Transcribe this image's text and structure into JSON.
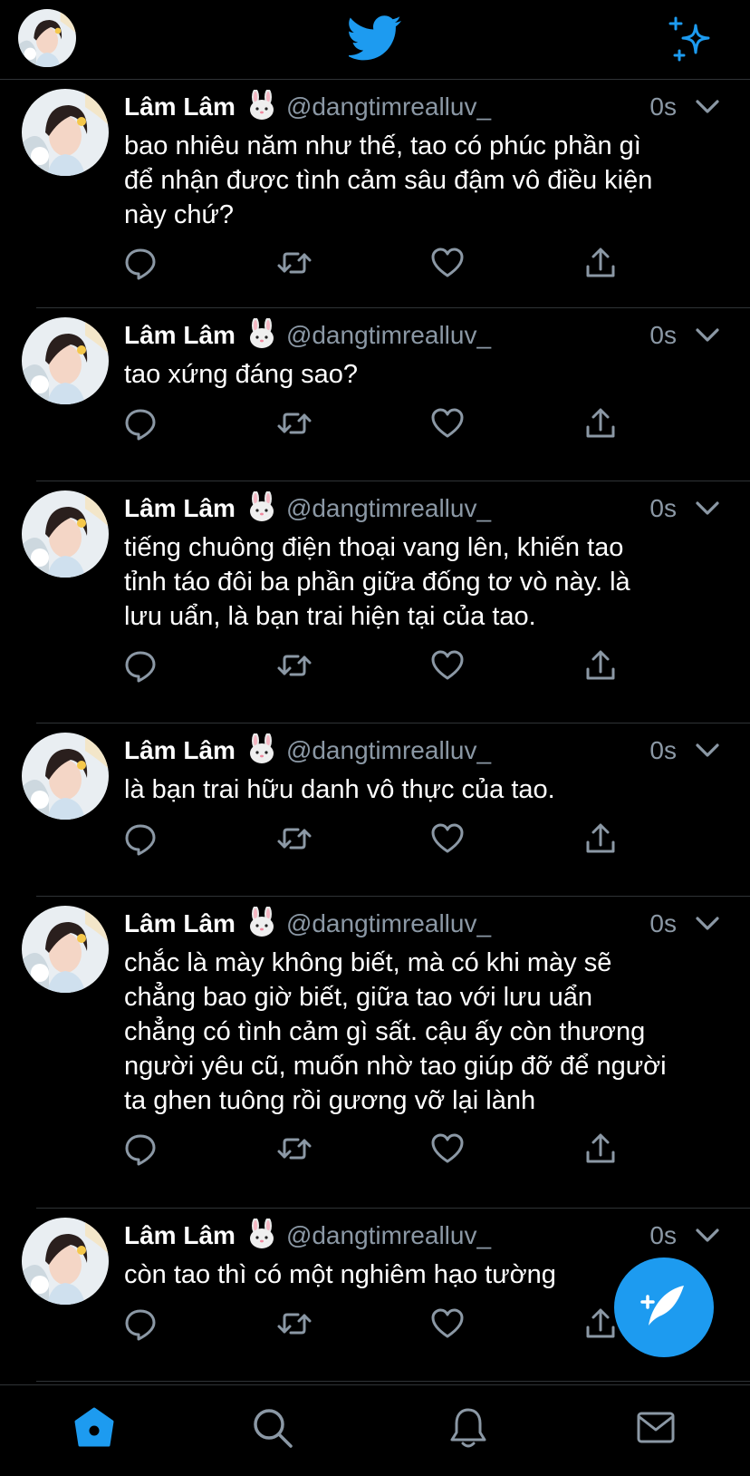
{
  "header": {
    "logo": "twitter-bird-icon",
    "right_icon": "sparkle-icon"
  },
  "tweets": [
    {
      "name": "Lâm Lâm",
      "emoji": "rabbit-face",
      "handle": "@dangtimrealluv_",
      "time": "0s",
      "lines": [
        "bao nhiêu năm như thế, tao có phúc phần gì",
        "để nhận được tình cảm sâu đậm vô điều kiện",
        "này chứ?"
      ]
    },
    {
      "name": "Lâm Lâm",
      "emoji": "rabbit-face",
      "handle": "@dangtimrealluv_",
      "time": "0s",
      "lines": [
        "tao xứng đáng sao?"
      ]
    },
    {
      "name": "Lâm Lâm",
      "emoji": "rabbit-face",
      "handle": "@dangtimrealluv_",
      "time": "0s",
      "lines": [
        "tiếng chuông điện thoại vang lên, khiến tao",
        "tỉnh táo đôi ba phần giữa đống tơ vò này. là",
        "lưu uẩn, là bạn trai hiện tại của tao."
      ]
    },
    {
      "name": "Lâm Lâm",
      "emoji": "rabbit-face",
      "handle": "@dangtimrealluv_",
      "time": "0s",
      "lines": [
        "là bạn trai hữu danh vô thực của tao."
      ]
    },
    {
      "name": "Lâm Lâm",
      "emoji": "rabbit-face",
      "handle": "@dangtimrealluv_",
      "time": "0s",
      "lines": [
        "chắc là mày không biết, mà có khi mày sẽ",
        "chẳng bao giờ biết, giữa tao với lưu uẩn",
        "chẳng có tình cảm gì sất. cậu ấy còn thương",
        "người yêu cũ, muốn nhờ tao giúp đỡ để người",
        "ta ghen tuông rồi gương vỡ lại lành"
      ]
    },
    {
      "name": "Lâm Lâm",
      "emoji": "rabbit-face",
      "handle": "@dangtimrealluv_",
      "time": "0s",
      "lines": [
        "còn tao thì có một nghiêm hạo tường"
      ]
    }
  ],
  "actions": [
    "reply-icon",
    "retweet-icon",
    "like-icon",
    "share-icon"
  ],
  "fab": "compose-tweet-icon",
  "bottom_nav": [
    "home-icon",
    "search-icon",
    "notifications-icon",
    "messages-icon"
  ],
  "colors": {
    "accent": "#1d9bf0",
    "background": "#000000",
    "muted": "#8b98a5",
    "divider": "#2f3336"
  }
}
